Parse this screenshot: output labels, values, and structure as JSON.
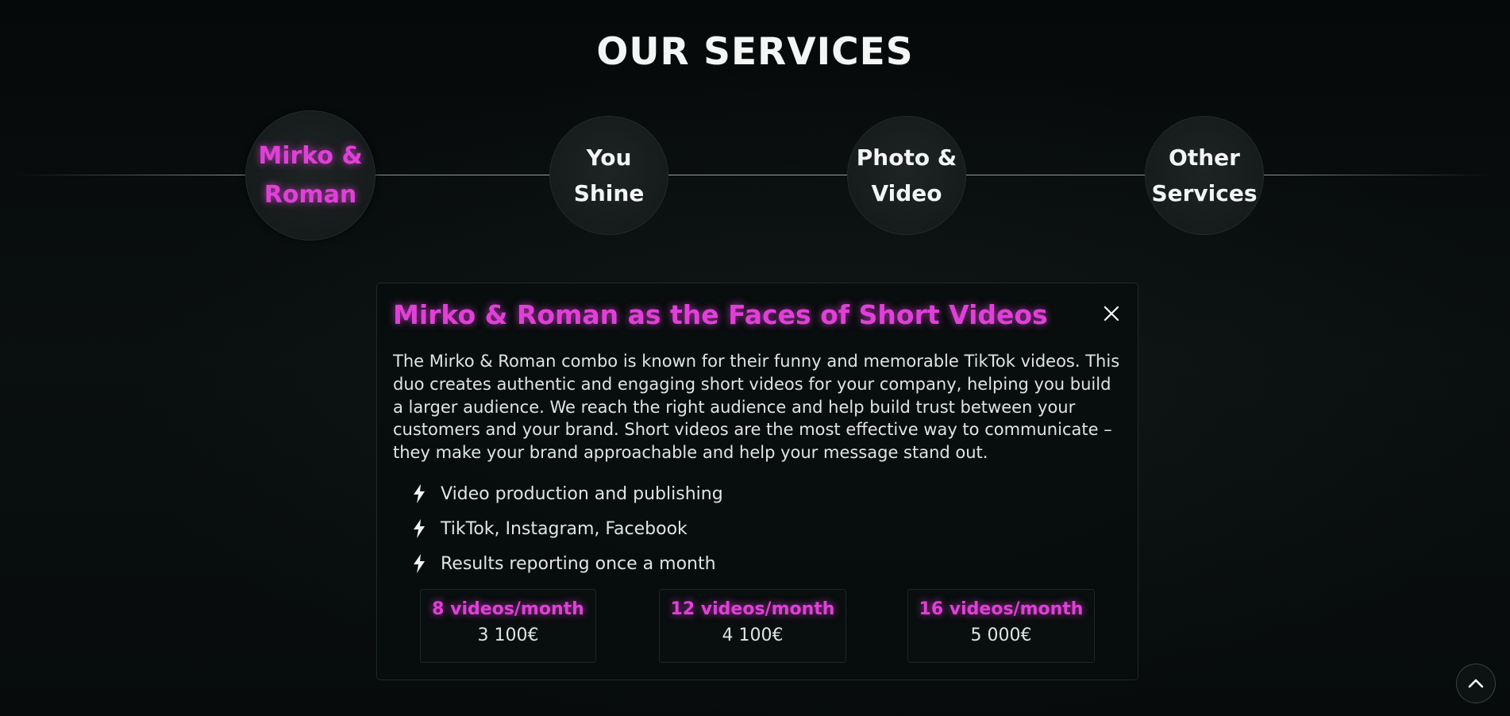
{
  "section": {
    "title": "OUR SERVICES"
  },
  "timeline": {
    "items": [
      {
        "label": "Mirko &\nRoman",
        "active": true
      },
      {
        "label": "You\nShine",
        "active": false
      },
      {
        "label": "Photo &\nVideo",
        "active": false
      },
      {
        "label": "Other\nServices",
        "active": false
      }
    ]
  },
  "panel": {
    "title": "Mirko & Roman as the Faces of Short Videos",
    "description": "The Mirko & Roman combo is known for their funny and memorable TikTok videos. This duo creates authentic and engaging short videos for your company, helping you build a larger audience. We reach the right audience and help build trust between your customers and your brand. Short videos are the most effective way to communicate – they make your brand approachable and help your message stand out.",
    "features": [
      "Video production and publishing",
      "TikTok, Instagram, Facebook",
      "Results reporting once a month"
    ],
    "plans": [
      {
        "name": "8 videos/month",
        "price": "3 100€"
      },
      {
        "name": "12 videos/month",
        "price": "4 100€"
      },
      {
        "name": "16 videos/month",
        "price": "5 000€"
      }
    ]
  },
  "icons": {
    "feature_icon": "lightning-bolt-icon",
    "close_icon": "close-icon",
    "scroll_top_icon": "chevron-up-icon"
  },
  "colors": {
    "accent": "#e040d8",
    "background": "#070b0b",
    "text": "#e2e4e4"
  }
}
